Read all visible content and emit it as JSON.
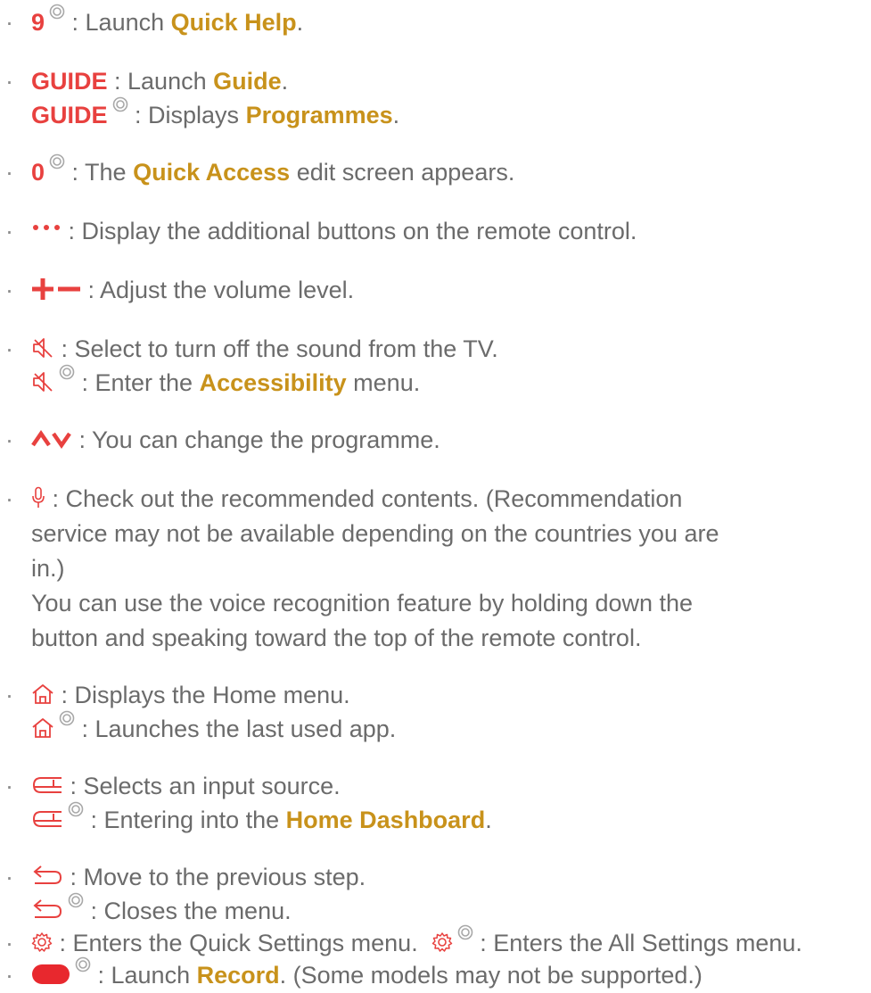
{
  "colors": {
    "text": "#6b6b6b",
    "button": "#e8413f",
    "menu": "#c8921b"
  },
  "icons": {
    "hold": "double-circle-icon",
    "more": "three-dots-icon",
    "volume": "plus-minus-icon",
    "mute": "mute-icon",
    "channel": "channel-up-down-icon",
    "mic": "microphone-icon",
    "home": "home-icon",
    "input": "input-source-icon",
    "back": "back-arrow-icon",
    "settings": "gear-icon",
    "record": "record-button-icon"
  },
  "items": {
    "i1": {
      "key": "9",
      "pre": " : Launch ",
      "menu": "Quick Help",
      "post": "."
    },
    "i2a": {
      "key": "GUIDE",
      "pre": " : Launch ",
      "menu": "Guide",
      "post": "."
    },
    "i2b": {
      "key": "GUIDE",
      "pre": " : Displays ",
      "menu": "Programmes",
      "post": "."
    },
    "i3": {
      "key": "0",
      "pre": " : The ",
      "menu": "Quick Access",
      "post": " edit screen appears."
    },
    "i4": {
      "text": " : Display the additional buttons on the remote control."
    },
    "i5": {
      "text": " : Adjust the volume level."
    },
    "i6a": {
      "text": " : Select to turn off the sound from the TV."
    },
    "i6b": {
      "pre": " : Enter the ",
      "menu": "Accessibility",
      "post": " menu."
    },
    "i7": {
      "text": " : You can change the programme."
    },
    "i8": {
      "l1": " : Check out the recommended contents. (Recommendation",
      "l2": "service may not be available depending on the countries you are",
      "l3": "in.)",
      "l4": "You can use the voice recognition feature by holding down the",
      "l5": "button and speaking toward the top of the remote control."
    },
    "i9a": {
      "text": " : Displays the Home menu."
    },
    "i9b": {
      "text": " : Launches the last used app."
    },
    "i10a": {
      "text": " : Selects an input source."
    },
    "i10b": {
      "pre": " : Entering into the ",
      "menu": "Home Dashboard",
      "post": "."
    },
    "i11a": {
      "text": " : Move to the previous step."
    },
    "i11b": {
      "text": " : Closes the menu."
    },
    "i12a": {
      "text": " : Enters the Quick Settings menu."
    },
    "i12b": {
      "text": " : Enters the All Settings menu."
    },
    "i13": {
      "pre": " : Launch ",
      "menu": "Record",
      "post": ". (Some models may not be supported.)"
    }
  }
}
